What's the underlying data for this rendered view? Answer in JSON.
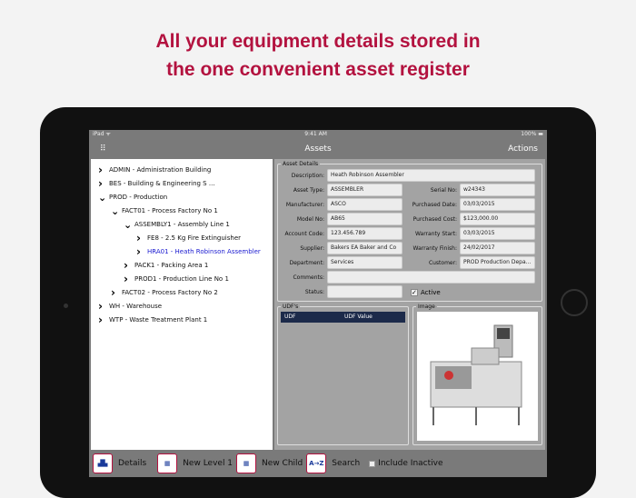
{
  "headline": {
    "line1": "All your equipment details stored in",
    "line2": "the one convenient asset register"
  },
  "status_bar": {
    "device": "iPad ᯤ",
    "time": "9:41 AM",
    "battery": "100% ▬"
  },
  "nav": {
    "title": "Assets",
    "actions": "Actions"
  },
  "tree": [
    {
      "label": "ADMIN - Administration Building",
      "level": 0,
      "expanded": false
    },
    {
      "label": "BES - Building & Engineering S ...",
      "level": 0,
      "expanded": false
    },
    {
      "label": "PROD - Production",
      "level": 0,
      "expanded": true
    },
    {
      "label": "FACT01 - Process Factory No 1",
      "level": 1,
      "expanded": true
    },
    {
      "label": "ASSEMBLY1 - Assembly Line 1",
      "level": 2,
      "expanded": true
    },
    {
      "label": "FE8 - 2.5 Kg Fire Extinguisher",
      "level": 3,
      "expanded": false
    },
    {
      "label": "HRA01 - Heath Robinson Assembler",
      "level": 3,
      "expanded": false,
      "selected": true
    },
    {
      "label": "PACK1 - Packing Area 1",
      "level": 2,
      "expanded": false
    },
    {
      "label": "PROD1 - Production Line No 1",
      "level": 2,
      "expanded": false
    },
    {
      "label": "FACT02 - Process Factory No 2",
      "level": 1,
      "expanded": false
    },
    {
      "label": "WH - Warehouse",
      "level": 0,
      "expanded": false
    },
    {
      "label": "WTP - Waste Treatment Plant 1",
      "level": 0,
      "expanded": false
    }
  ],
  "details": {
    "legend": "Asset Details",
    "description_label": "Description:",
    "description": "Heath Robinson Assembler",
    "asset_type_label": "Asset Type:",
    "asset_type": "ASSEMBLER",
    "serial_label": "Serial No:",
    "serial": "w24343",
    "manufacturer_label": "Manufacturer:",
    "manufacturer": "ASCO",
    "purchased_date_label": "Purchased Date:",
    "purchased_date": "03/03/2015",
    "model_label": "Model No:",
    "model": "AB65",
    "purchased_cost_label": "Purchased Cost:",
    "purchased_cost": "$123,000.00",
    "account_label": "Account Code:",
    "account": "123.456.789",
    "warranty_start_label": "Warranty Start:",
    "warranty_start": "03/03/2015",
    "supplier_label": "Supplier:",
    "supplier": "Bakers EA Baker and Co",
    "warranty_finish_label": "Warranty Finish:",
    "warranty_finish": "24/02/2017",
    "department_label": "Department:",
    "department": "Services",
    "customer_label": "Customer:",
    "customer": "PROD Production Depa...",
    "comments_label": "Comments:",
    "comments": "",
    "status_label": "Status:",
    "status": "",
    "active_label": "Active",
    "active": true
  },
  "udfs": {
    "legend": "UDF's",
    "col1": "UDF",
    "col2": "UDF Value"
  },
  "image": {
    "legend": "Image"
  },
  "toolbar": {
    "details": "Details",
    "new_level1": "New Level 1",
    "new_child": "New Child",
    "search": "Search",
    "search_icon": "A→Z",
    "include_inactive": "Include Inactive"
  }
}
